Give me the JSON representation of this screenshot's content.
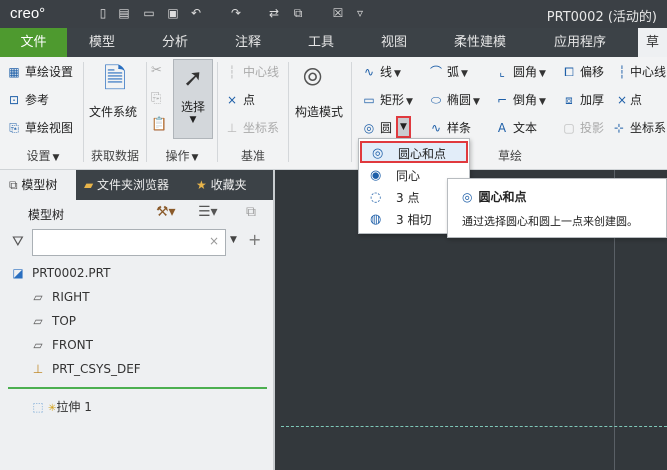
{
  "app": {
    "logo": "creo°",
    "window_title": "PRT0002 (活动的)"
  },
  "tabs": [
    "文件",
    "模型",
    "分析",
    "注释",
    "工具",
    "视图",
    "柔性建模",
    "应用程序"
  ],
  "active_tab_label": "草",
  "ribbon": {
    "setup": {
      "sketch_setup": "草绘设置",
      "reference": "参考",
      "sketch_view": "草绘视图",
      "group": "设置"
    },
    "get_data": {
      "file_system": "文件系统",
      "group": "获取数据"
    },
    "operations": {
      "select": "选择",
      "group": "操作"
    },
    "datum": {
      "centerline": "中心线",
      "point": "点",
      "csys": "坐标系",
      "group": "基准"
    },
    "construction_mode": "构造模式",
    "sketch": {
      "line": "线",
      "arc": "弧",
      "fillet": "圆角",
      "offset": "偏移",
      "centerline2": "中心线",
      "rectangle": "矩形",
      "ellipse": "椭圆",
      "chamfer": "倒角",
      "thicken": "加厚",
      "point2": "点",
      "circle": "圆",
      "spline": "样条",
      "text": "文本",
      "project": "投影",
      "csys2": "坐标系",
      "group": "草绘"
    }
  },
  "pane_tabs": {
    "model_tree": "模型树",
    "folder_browser": "文件夹浏览器",
    "favorites": "收藏夹"
  },
  "tree": {
    "header": "模型树",
    "filter_placeholder": "",
    "items": [
      {
        "label": "PRT0002.PRT",
        "icon": "part-icon"
      },
      {
        "label": "RIGHT",
        "icon": "datum-plane-icon"
      },
      {
        "label": "TOP",
        "icon": "datum-plane-icon"
      },
      {
        "label": "FRONT",
        "icon": "datum-plane-icon"
      },
      {
        "label": "PRT_CSYS_DEF",
        "icon": "csys-icon"
      }
    ],
    "feature": "拉伸 1"
  },
  "dropdown": {
    "items": [
      "圆心和点",
      "同心",
      "3 点",
      "3 相切"
    ]
  },
  "tooltip": {
    "title": "圆心和点",
    "text": "通过选择圆心和圆上一点来创建圆。"
  },
  "colors": {
    "accent_green": "#4e9a2f",
    "canvas": "#33383c",
    "highlight_red": "#e0393e"
  }
}
